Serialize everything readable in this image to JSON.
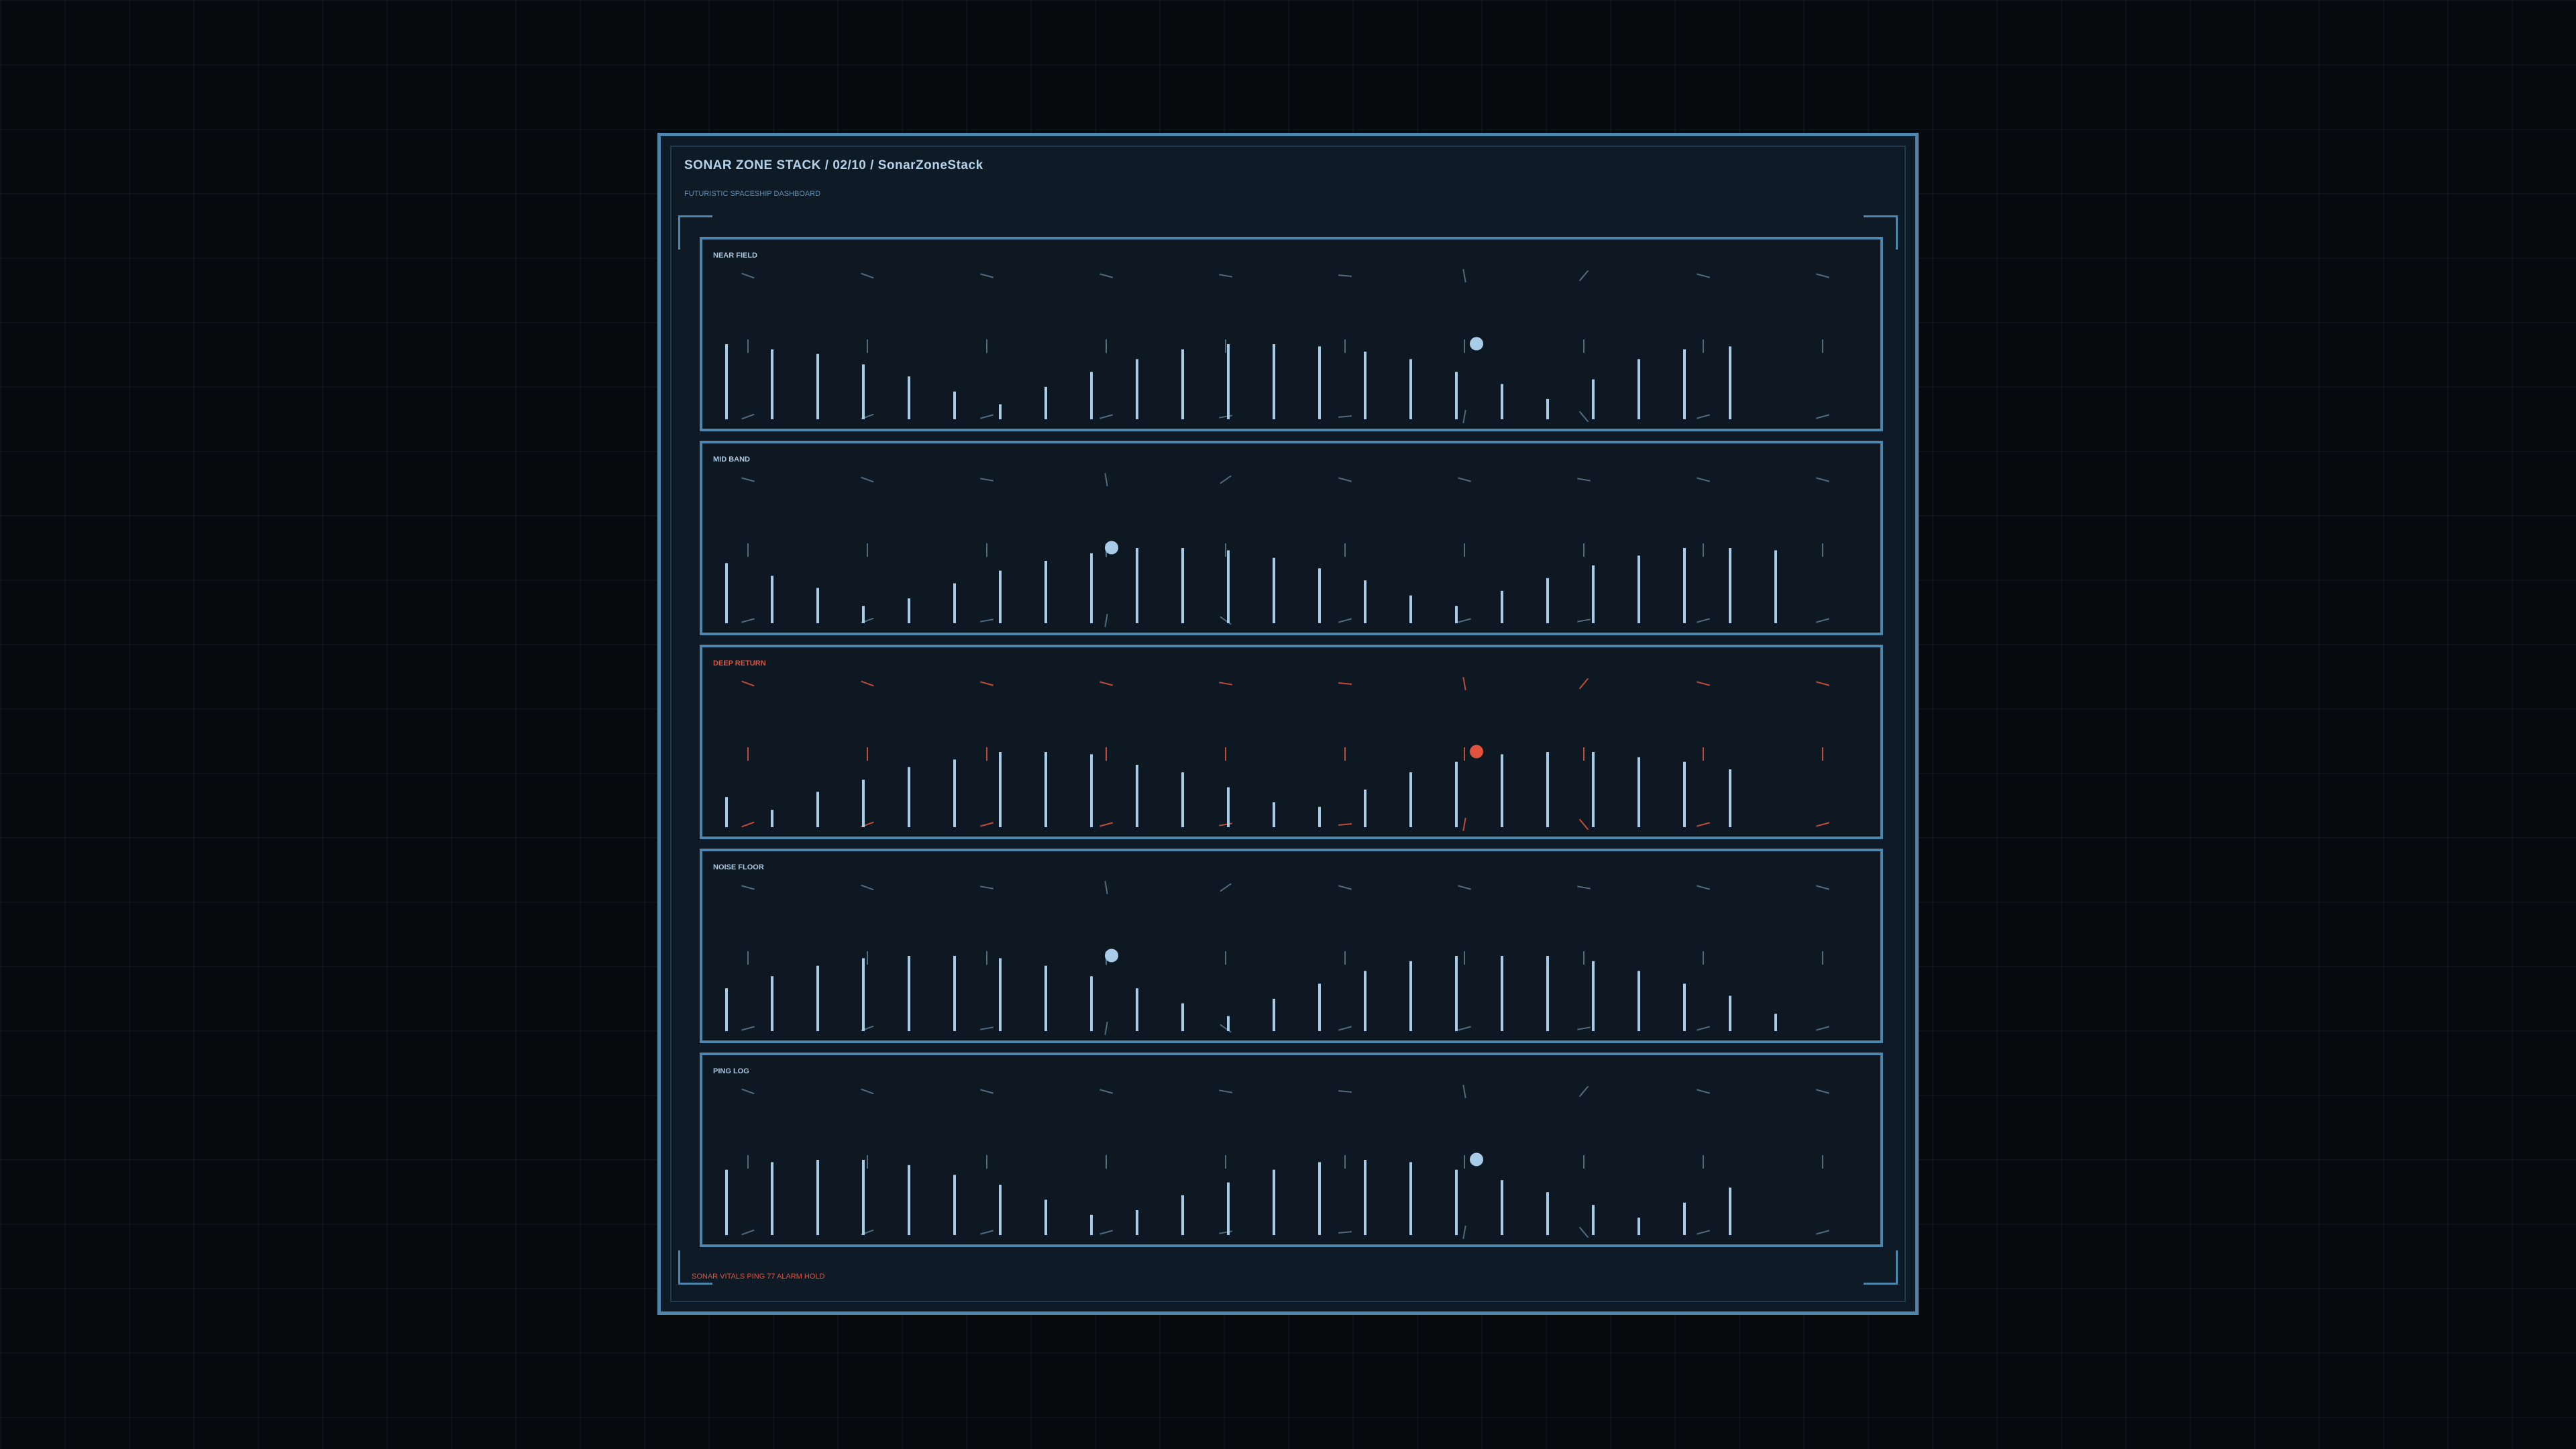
{
  "header": {
    "title": "SONAR ZONE STACK / 02/10 / SonarZoneStack",
    "subtitle": "FUTURISTIC SPACESHIP DASHBOARD"
  },
  "footer": {
    "status": "SONAR VITALS PING 77 ALARM HOLD"
  },
  "colors": {
    "accent": "#4f86ad",
    "bar": "#a9cde8",
    "marker": "#a9cde8",
    "alert": "#e2533d",
    "tick": "#6f8ea6"
  },
  "chart_data": [
    {
      "type": "bar",
      "label": "NEAR FIELD",
      "alert": false,
      "ylim": [
        0,
        1
      ],
      "values": [
        1.0,
        0.93,
        0.87,
        0.73,
        0.57,
        0.37,
        0.2,
        0.43,
        0.63,
        0.8,
        0.93,
        1.0,
        1.0,
        0.97,
        0.9,
        0.8,
        0.63,
        0.47,
        0.27,
        0.53,
        0.8,
        0.93,
        0.97
      ],
      "marker_index": 16,
      "marker_value": 0.97,
      "dial_angles": [
        [
          20,
          90,
          160
        ],
        [
          20,
          90,
          160
        ],
        [
          15,
          90,
          165
        ],
        [
          15,
          90,
          165
        ],
        [
          10,
          90,
          170
        ],
        [
          5,
          90,
          175
        ],
        [
          80,
          90,
          100
        ],
        [
          130,
          90,
          50
        ],
        [
          15,
          90,
          165
        ],
        [
          15,
          90,
          165
        ]
      ]
    },
    {
      "type": "bar",
      "label": "MID BAND",
      "alert": false,
      "ylim": [
        0,
        1
      ],
      "values": [
        0.8,
        0.63,
        0.47,
        0.23,
        0.33,
        0.53,
        0.7,
        0.83,
        0.93,
        1.0,
        1.0,
        0.97,
        0.87,
        0.73,
        0.57,
        0.37,
        0.23,
        0.43,
        0.6,
        0.77,
        0.9,
        1.0,
        1.0,
        0.97
      ],
      "marker_index": 8,
      "marker_value": 0.97,
      "dial_angles": [
        [
          15,
          90,
          165
        ],
        [
          20,
          90,
          160
        ],
        [
          10,
          90,
          170
        ],
        [
          80,
          90,
          100
        ],
        [
          145,
          90,
          35
        ],
        [
          15,
          90,
          165
        ],
        [
          15,
          90,
          165
        ],
        [
          10,
          90,
          170
        ],
        [
          15,
          90,
          165
        ],
        [
          15,
          90,
          165
        ]
      ]
    },
    {
      "type": "bar",
      "label": "DEEP RETURN",
      "alert": true,
      "ylim": [
        0,
        1
      ],
      "values": [
        0.4,
        0.23,
        0.47,
        0.63,
        0.8,
        0.9,
        1.0,
        1.0,
        0.97,
        0.83,
        0.73,
        0.53,
        0.33,
        0.27,
        0.5,
        0.73,
        0.87,
        0.97,
        1.0,
        1.0,
        0.93,
        0.87,
        0.77
      ],
      "marker_index": 16,
      "marker_value": 0.97,
      "dial_angles": [
        [
          20,
          90,
          160
        ],
        [
          20,
          90,
          160
        ],
        [
          15,
          90,
          165
        ],
        [
          15,
          90,
          165
        ],
        [
          10,
          90,
          170
        ],
        [
          5,
          90,
          175
        ],
        [
          80,
          90,
          100
        ],
        [
          130,
          90,
          50
        ],
        [
          15,
          90,
          165
        ],
        [
          15,
          90,
          165
        ]
      ]
    },
    {
      "type": "bar",
      "label": "NOISE FLOOR",
      "alert": false,
      "ylim": [
        0,
        1
      ],
      "values": [
        0.57,
        0.73,
        0.87,
        0.97,
        1.0,
        1.0,
        0.97,
        0.87,
        0.73,
        0.57,
        0.37,
        0.2,
        0.43,
        0.63,
        0.8,
        0.93,
        1.0,
        1.0,
        1.0,
        0.93,
        0.8,
        0.63,
        0.47,
        0.23
      ],
      "marker_index": 8,
      "marker_value": 0.97,
      "dial_angles": [
        [
          15,
          90,
          165
        ],
        [
          20,
          90,
          160
        ],
        [
          10,
          90,
          170
        ],
        [
          80,
          90,
          100
        ],
        [
          145,
          90,
          35
        ],
        [
          15,
          90,
          165
        ],
        [
          15,
          90,
          165
        ],
        [
          10,
          90,
          170
        ],
        [
          15,
          90,
          165
        ],
        [
          15,
          90,
          165
        ]
      ]
    },
    {
      "type": "bar",
      "label": "PING LOG",
      "alert": false,
      "ylim": [
        0,
        1
      ],
      "values": [
        0.87,
        0.97,
        1.0,
        1.0,
        0.93,
        0.8,
        0.67,
        0.47,
        0.27,
        0.33,
        0.53,
        0.7,
        0.87,
        0.97,
        1.0,
        0.97,
        0.87,
        0.73,
        0.57,
        0.4,
        0.23,
        0.43,
        0.63
      ],
      "marker_index": 16,
      "marker_value": 0.97,
      "dial_angles": [
        [
          20,
          90,
          160
        ],
        [
          20,
          90,
          160
        ],
        [
          15,
          90,
          165
        ],
        [
          15,
          90,
          165
        ],
        [
          10,
          90,
          170
        ],
        [
          5,
          90,
          175
        ],
        [
          80,
          90,
          100
        ],
        [
          130,
          90,
          50
        ],
        [
          15,
          90,
          165
        ],
        [
          15,
          90,
          165
        ]
      ]
    }
  ]
}
